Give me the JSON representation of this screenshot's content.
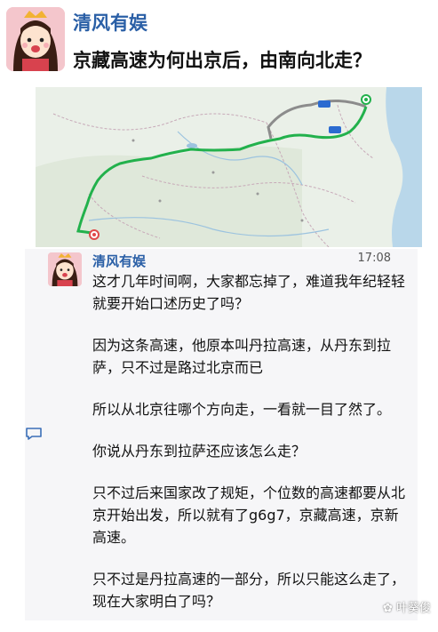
{
  "post": {
    "author": "清风有娱",
    "question": "京藏高速为何出京后，由南向北走？"
  },
  "map": {
    "route_color": "#22b14c",
    "alt_route_color": "#8c8c8c",
    "badge_g6": "G6",
    "badge_g7": "G7"
  },
  "chat": {
    "name": "清风有娱",
    "time": "17:08",
    "paragraphs": [
      "这才几年时间啊，大家都忘掉了，难道我年纪轻轻就要开始口述历史了吗？",
      "因为这条高速，他原本叫丹拉高速，从丹东到拉萨，只不过是路过北京而已",
      "所以从北京往哪个方向走，一看就一目了然了。",
      "你说从丹东到拉萨还应该怎么走？",
      "只不过后来国家改了规矩，个位数的高速都要从北京开始出发，所以就有了g6g7，京藏高速，京新高速。",
      "只不过是丹拉高速的一部分，所以只能这么走了，现在大家明白了吗？"
    ]
  },
  "watermark": "叶葵俊",
  "icons": [
    "avatar",
    "map-start-pin",
    "map-end-pin",
    "comment-icon",
    "watermark-icon"
  ]
}
